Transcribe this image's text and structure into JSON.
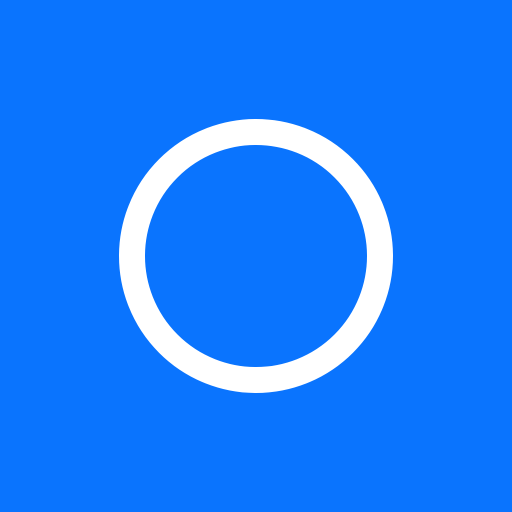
{
  "icon": {
    "name": "circle-icon",
    "colors": {
      "background": "#0A74FE",
      "ring": "#FFFFFF"
    }
  }
}
